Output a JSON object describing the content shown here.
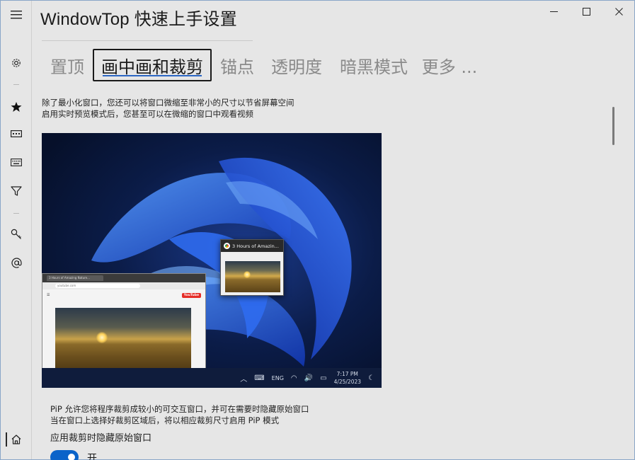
{
  "app": {
    "title": "WindowTop 快速上手设置"
  },
  "window_controls": {
    "minimize_icon": "minimize-icon",
    "maximize_icon": "maximize-icon",
    "close_icon": "close-icon"
  },
  "rail": {
    "items": [
      {
        "id": "menu",
        "icon": "hamburger-icon"
      },
      {
        "id": "settings",
        "icon": "gear-icon"
      },
      {
        "id": "favorites",
        "icon": "star-icon"
      },
      {
        "id": "window",
        "icon": "window-bar-icon"
      },
      {
        "id": "keyboard",
        "icon": "keyboard-icon"
      },
      {
        "id": "filter",
        "icon": "filter-icon"
      },
      {
        "id": "key",
        "icon": "key-icon"
      },
      {
        "id": "contact",
        "icon": "at-icon"
      },
      {
        "id": "home",
        "icon": "home-icon"
      }
    ]
  },
  "tabs": [
    {
      "label": "置顶",
      "active": false
    },
    {
      "label": "画中画和裁剪",
      "active": true
    },
    {
      "label": "锚点",
      "active": false
    },
    {
      "label": "透明度",
      "active": false
    },
    {
      "label": "暗黑模式",
      "active": false
    },
    {
      "label": "更多 ...",
      "active": false
    }
  ],
  "intro": {
    "line1": "除了最小化窗口，您还可以将窗口微缩至非常小的尺寸以节省屏幕空间",
    "line2": "启用实时预览模式后，您甚至可以在微缩的窗口中观看视频"
  },
  "demo": {
    "pip_title": "3 Hours of Amazin...",
    "browser_tab": "3 Hours of Amazing Nature...",
    "browser_url": "youtube.com",
    "yt_label": "YouTube",
    "taskbar_lang": "ENG",
    "clock_time": "7:17 PM",
    "clock_date": "4/25/2023"
  },
  "pip_desc": {
    "line1": "PiP 允许您将程序裁剪成较小的可交互窗口，并可在需要时隐藏原始窗口",
    "line2": "当在窗口上选择好裁剪区域后，将以相应裁剪尺寸启用 PiP 模式"
  },
  "setting": {
    "label": "应用裁剪时隐藏原始窗口",
    "toggle_state": "开"
  },
  "colors": {
    "accent": "#0a63c9",
    "tab_underline": "#2b66c4"
  }
}
